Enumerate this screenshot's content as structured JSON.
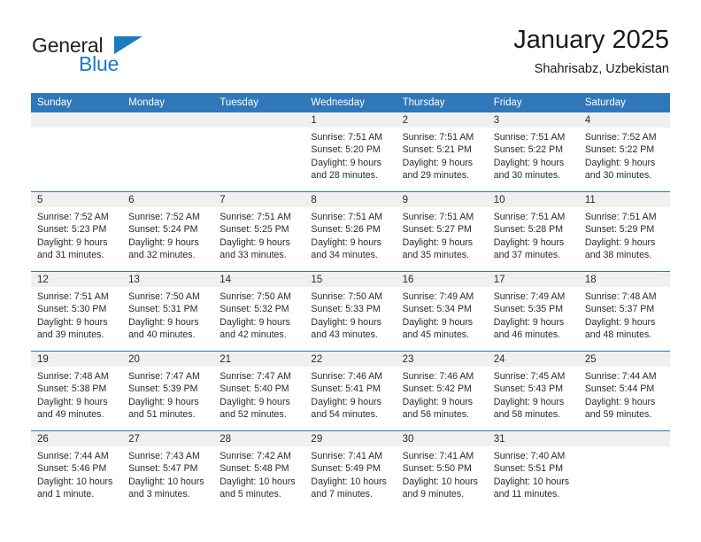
{
  "brand": {
    "name_part1": "General",
    "name_part2": "Blue",
    "accent_color": "#1c7ac0",
    "triangle_icon": "triangle-icon"
  },
  "header": {
    "title": "January 2025",
    "subtitle": "Shahrisabz, Uzbekistan"
  },
  "colors": {
    "header_blue": "#3178b9",
    "daynum_band": "#f0f0f0",
    "text": "#2a2a2a"
  },
  "weekday_headers": [
    "Sunday",
    "Monday",
    "Tuesday",
    "Wednesday",
    "Thursday",
    "Friday",
    "Saturday"
  ],
  "weeks": [
    [
      {
        "day": "",
        "lines": []
      },
      {
        "day": "",
        "lines": []
      },
      {
        "day": "",
        "lines": []
      },
      {
        "day": "1",
        "lines": [
          "Sunrise: 7:51 AM",
          "Sunset: 5:20 PM",
          "Daylight: 9 hours",
          "and 28 minutes."
        ]
      },
      {
        "day": "2",
        "lines": [
          "Sunrise: 7:51 AM",
          "Sunset: 5:21 PM",
          "Daylight: 9 hours",
          "and 29 minutes."
        ]
      },
      {
        "day": "3",
        "lines": [
          "Sunrise: 7:51 AM",
          "Sunset: 5:22 PM",
          "Daylight: 9 hours",
          "and 30 minutes."
        ]
      },
      {
        "day": "4",
        "lines": [
          "Sunrise: 7:52 AM",
          "Sunset: 5:22 PM",
          "Daylight: 9 hours",
          "and 30 minutes."
        ]
      }
    ],
    [
      {
        "day": "5",
        "lines": [
          "Sunrise: 7:52 AM",
          "Sunset: 5:23 PM",
          "Daylight: 9 hours",
          "and 31 minutes."
        ]
      },
      {
        "day": "6",
        "lines": [
          "Sunrise: 7:52 AM",
          "Sunset: 5:24 PM",
          "Daylight: 9 hours",
          "and 32 minutes."
        ]
      },
      {
        "day": "7",
        "lines": [
          "Sunrise: 7:51 AM",
          "Sunset: 5:25 PM",
          "Daylight: 9 hours",
          "and 33 minutes."
        ]
      },
      {
        "day": "8",
        "lines": [
          "Sunrise: 7:51 AM",
          "Sunset: 5:26 PM",
          "Daylight: 9 hours",
          "and 34 minutes."
        ]
      },
      {
        "day": "9",
        "lines": [
          "Sunrise: 7:51 AM",
          "Sunset: 5:27 PM",
          "Daylight: 9 hours",
          "and 35 minutes."
        ]
      },
      {
        "day": "10",
        "lines": [
          "Sunrise: 7:51 AM",
          "Sunset: 5:28 PM",
          "Daylight: 9 hours",
          "and 37 minutes."
        ]
      },
      {
        "day": "11",
        "lines": [
          "Sunrise: 7:51 AM",
          "Sunset: 5:29 PM",
          "Daylight: 9 hours",
          "and 38 minutes."
        ]
      }
    ],
    [
      {
        "day": "12",
        "lines": [
          "Sunrise: 7:51 AM",
          "Sunset: 5:30 PM",
          "Daylight: 9 hours",
          "and 39 minutes."
        ]
      },
      {
        "day": "13",
        "lines": [
          "Sunrise: 7:50 AM",
          "Sunset: 5:31 PM",
          "Daylight: 9 hours",
          "and 40 minutes."
        ]
      },
      {
        "day": "14",
        "lines": [
          "Sunrise: 7:50 AM",
          "Sunset: 5:32 PM",
          "Daylight: 9 hours",
          "and 42 minutes."
        ]
      },
      {
        "day": "15",
        "lines": [
          "Sunrise: 7:50 AM",
          "Sunset: 5:33 PM",
          "Daylight: 9 hours",
          "and 43 minutes."
        ]
      },
      {
        "day": "16",
        "lines": [
          "Sunrise: 7:49 AM",
          "Sunset: 5:34 PM",
          "Daylight: 9 hours",
          "and 45 minutes."
        ]
      },
      {
        "day": "17",
        "lines": [
          "Sunrise: 7:49 AM",
          "Sunset: 5:35 PM",
          "Daylight: 9 hours",
          "and 46 minutes."
        ]
      },
      {
        "day": "18",
        "lines": [
          "Sunrise: 7:48 AM",
          "Sunset: 5:37 PM",
          "Daylight: 9 hours",
          "and 48 minutes."
        ]
      }
    ],
    [
      {
        "day": "19",
        "lines": [
          "Sunrise: 7:48 AM",
          "Sunset: 5:38 PM",
          "Daylight: 9 hours",
          "and 49 minutes."
        ]
      },
      {
        "day": "20",
        "lines": [
          "Sunrise: 7:47 AM",
          "Sunset: 5:39 PM",
          "Daylight: 9 hours",
          "and 51 minutes."
        ]
      },
      {
        "day": "21",
        "lines": [
          "Sunrise: 7:47 AM",
          "Sunset: 5:40 PM",
          "Daylight: 9 hours",
          "and 52 minutes."
        ]
      },
      {
        "day": "22",
        "lines": [
          "Sunrise: 7:46 AM",
          "Sunset: 5:41 PM",
          "Daylight: 9 hours",
          "and 54 minutes."
        ]
      },
      {
        "day": "23",
        "lines": [
          "Sunrise: 7:46 AM",
          "Sunset: 5:42 PM",
          "Daylight: 9 hours",
          "and 56 minutes."
        ]
      },
      {
        "day": "24",
        "lines": [
          "Sunrise: 7:45 AM",
          "Sunset: 5:43 PM",
          "Daylight: 9 hours",
          "and 58 minutes."
        ]
      },
      {
        "day": "25",
        "lines": [
          "Sunrise: 7:44 AM",
          "Sunset: 5:44 PM",
          "Daylight: 9 hours",
          "and 59 minutes."
        ]
      }
    ],
    [
      {
        "day": "26",
        "lines": [
          "Sunrise: 7:44 AM",
          "Sunset: 5:46 PM",
          "Daylight: 10 hours",
          "and 1 minute."
        ]
      },
      {
        "day": "27",
        "lines": [
          "Sunrise: 7:43 AM",
          "Sunset: 5:47 PM",
          "Daylight: 10 hours",
          "and 3 minutes."
        ]
      },
      {
        "day": "28",
        "lines": [
          "Sunrise: 7:42 AM",
          "Sunset: 5:48 PM",
          "Daylight: 10 hours",
          "and 5 minutes."
        ]
      },
      {
        "day": "29",
        "lines": [
          "Sunrise: 7:41 AM",
          "Sunset: 5:49 PM",
          "Daylight: 10 hours",
          "and 7 minutes."
        ]
      },
      {
        "day": "30",
        "lines": [
          "Sunrise: 7:41 AM",
          "Sunset: 5:50 PM",
          "Daylight: 10 hours",
          "and 9 minutes."
        ]
      },
      {
        "day": "31",
        "lines": [
          "Sunrise: 7:40 AM",
          "Sunset: 5:51 PM",
          "Daylight: 10 hours",
          "and 11 minutes."
        ]
      },
      {
        "day": "",
        "lines": []
      }
    ]
  ]
}
